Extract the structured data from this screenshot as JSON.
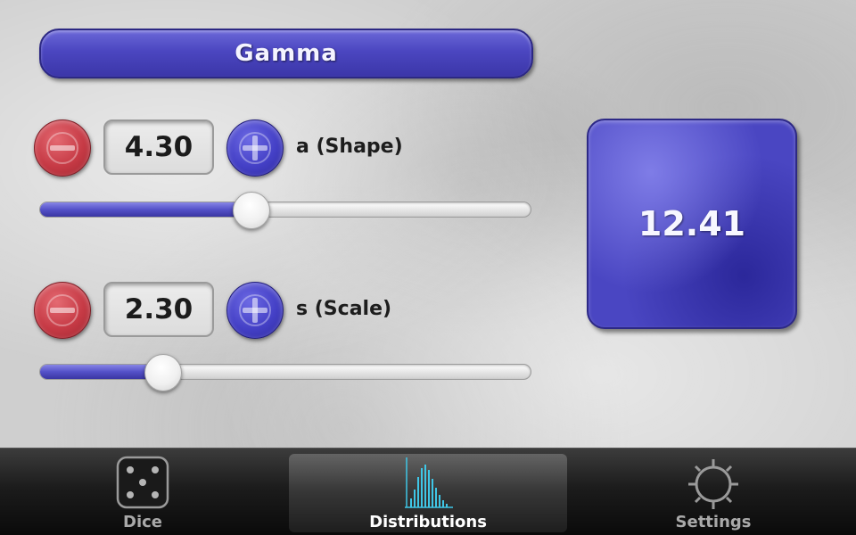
{
  "header": {
    "title": "Gamma"
  },
  "params": [
    {
      "value": "4.30",
      "label": "a (Shape)",
      "slider_fraction": 0.43
    },
    {
      "value": "2.30",
      "label": "s (Scale)",
      "slider_fraction": 0.25
    }
  ],
  "result": {
    "value": "12.41"
  },
  "tabs": [
    {
      "label": "Dice",
      "icon": "dice-icon",
      "selected": false
    },
    {
      "label": "Distributions",
      "icon": "histogram-icon",
      "selected": true
    },
    {
      "label": "Settings",
      "icon": "gear-icon",
      "selected": false
    }
  ],
  "colors": {
    "accent_blue": "#4a46c2",
    "minus_red": "#c63a45",
    "tab_active_text": "#ffffff",
    "tab_inactive_text": "#a9a9a9",
    "histogram_cyan": "#3fc6e6"
  }
}
